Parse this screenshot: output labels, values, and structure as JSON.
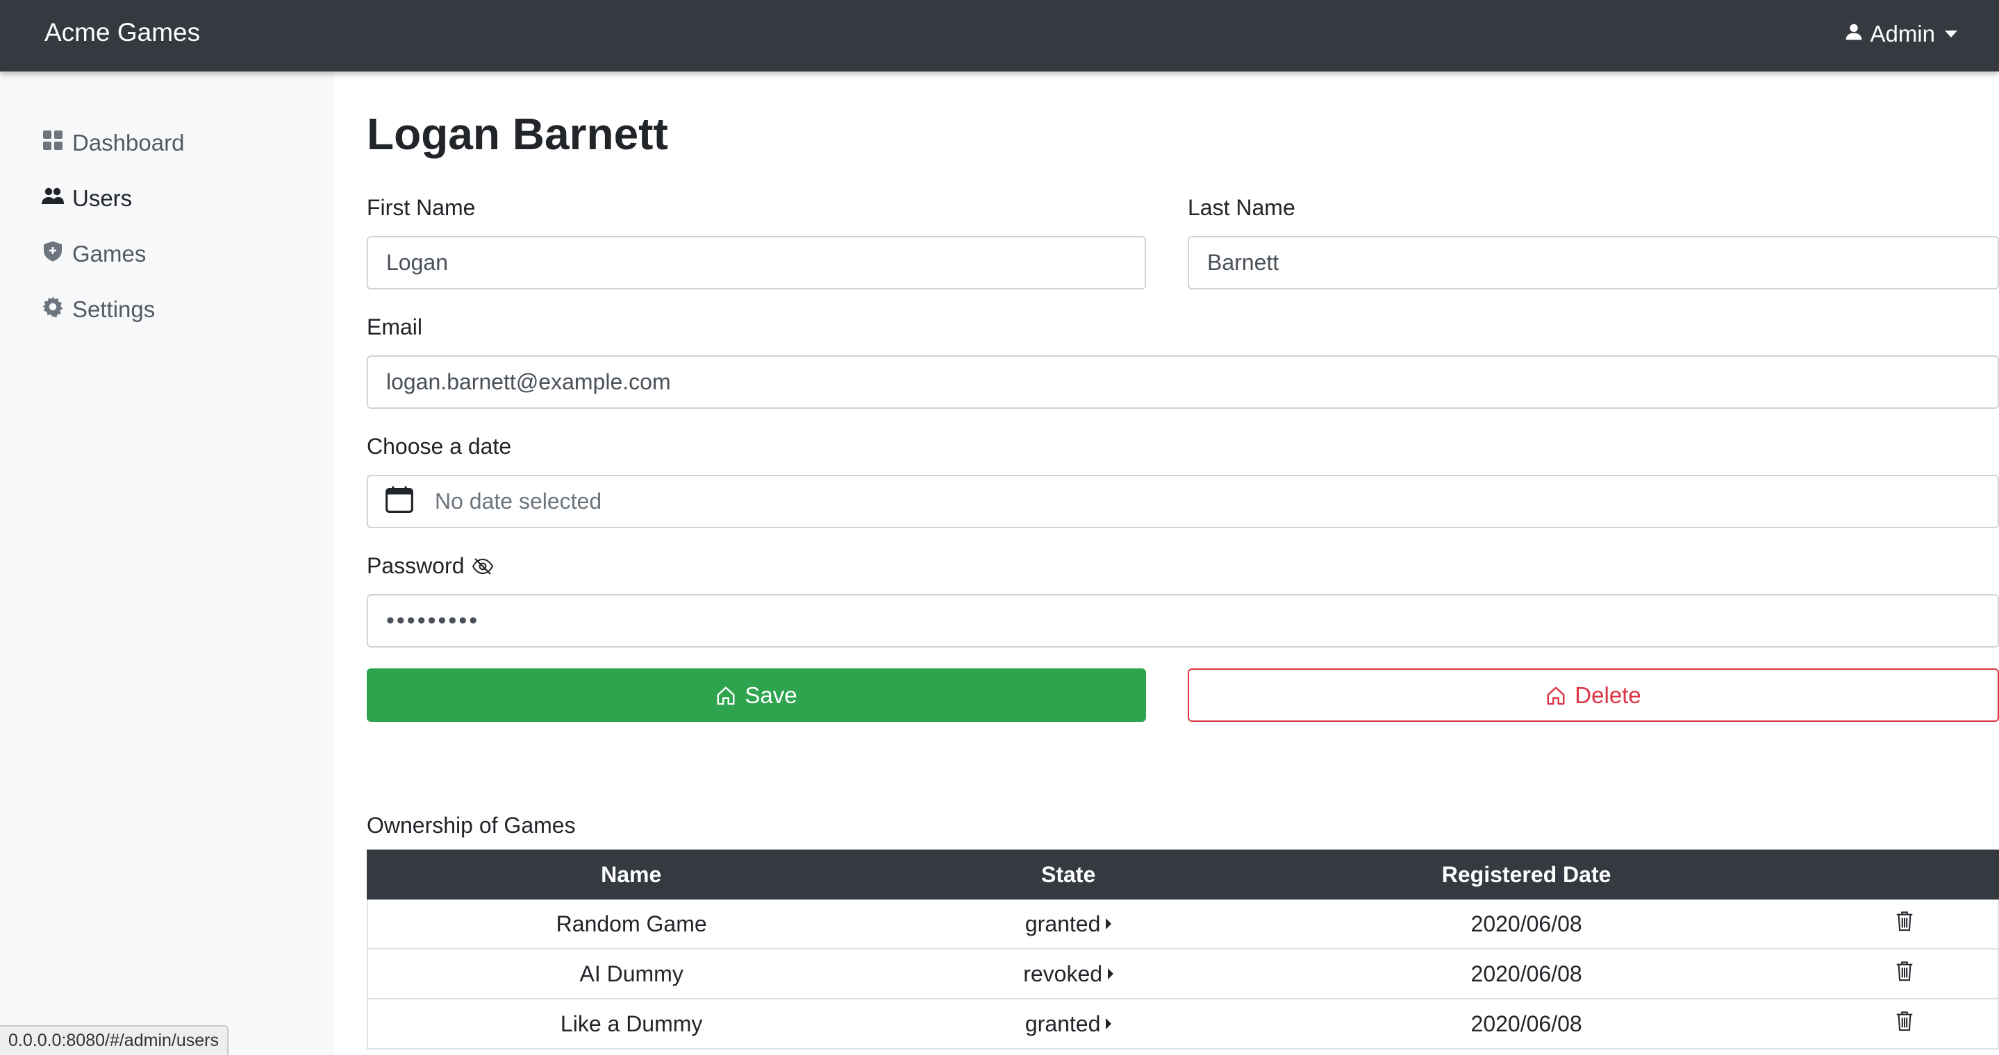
{
  "app": {
    "brand": "Acme Games",
    "user_menu_label": "Admin"
  },
  "sidebar": {
    "items": [
      {
        "label": "Dashboard",
        "icon": "dashboard-icon",
        "active": false
      },
      {
        "label": "Users",
        "icon": "users-icon",
        "active": true
      },
      {
        "label": "Games",
        "icon": "shield-icon",
        "active": false
      },
      {
        "label": "Settings",
        "icon": "gear-icon",
        "active": false
      }
    ]
  },
  "form": {
    "title": "Logan Barnett",
    "first_name": {
      "label": "First Name",
      "value": "Logan"
    },
    "last_name": {
      "label": "Last Name",
      "value": "Barnett"
    },
    "email": {
      "label": "Email",
      "value": "logan.barnett@example.com"
    },
    "date": {
      "label": "Choose a date",
      "placeholder": "No date selected"
    },
    "password": {
      "label": "Password",
      "value": "•••••••••"
    },
    "save_label": "Save",
    "delete_label": "Delete"
  },
  "ownership": {
    "caption": "Ownership of Games",
    "columns": [
      "Name",
      "State",
      "Registered Date",
      ""
    ],
    "rows": [
      {
        "name": "Random Game",
        "state": "granted",
        "date": "2020/06/08"
      },
      {
        "name": "AI Dummy",
        "state": "revoked",
        "date": "2020/06/08"
      },
      {
        "name": "Like a Dummy",
        "state": "granted",
        "date": "2020/06/08"
      }
    ]
  },
  "statusbar": {
    "url": "0.0.0.0:8080/#/admin/users"
  },
  "colors": {
    "navbar": "#343a40",
    "save": "#2ea44f",
    "delete": "#dc3545",
    "sidebar": "#f8f9fa"
  }
}
